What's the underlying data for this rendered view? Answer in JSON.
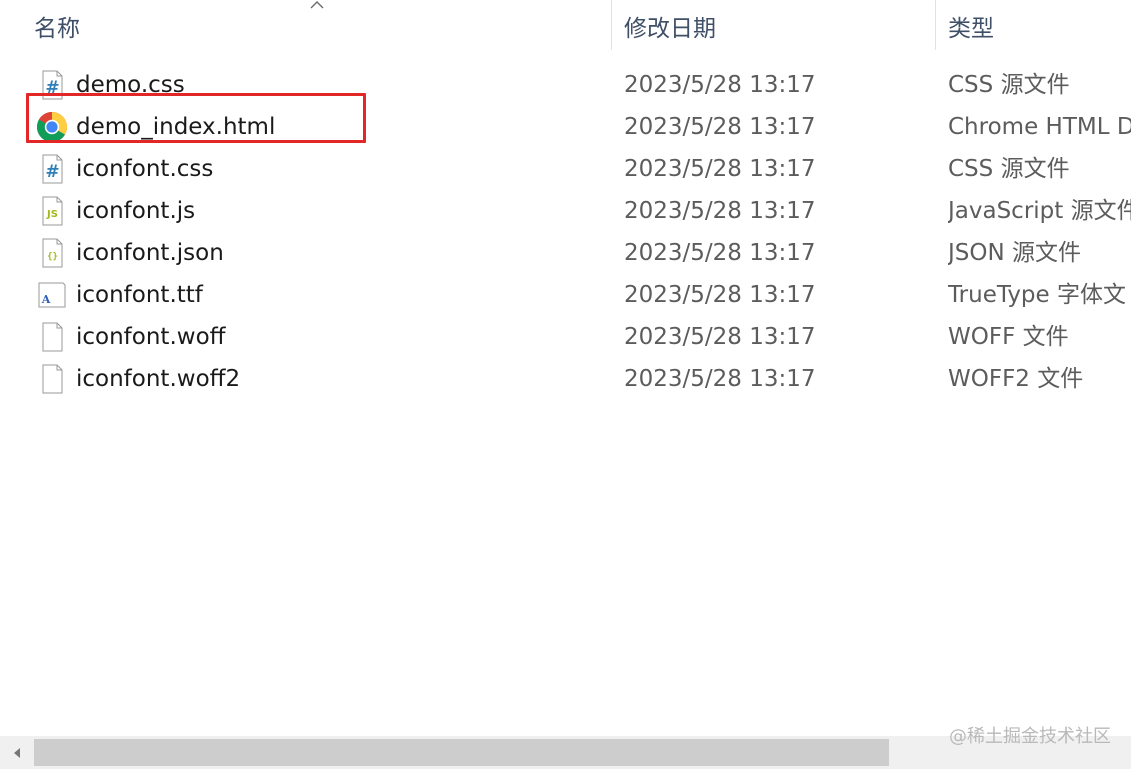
{
  "header": {
    "name": "名称",
    "date_modified": "修改日期",
    "type": "类型"
  },
  "files": [
    {
      "name": "demo.css",
      "date": "2023/5/28 13:17",
      "type": "CSS 源文件",
      "icon": "css-file-icon"
    },
    {
      "name": "demo_index.html",
      "date": "2023/5/28 13:17",
      "type": "Chrome HTML D",
      "icon": "chrome-icon"
    },
    {
      "name": "iconfont.css",
      "date": "2023/5/28 13:17",
      "type": "CSS 源文件",
      "icon": "css-file-icon"
    },
    {
      "name": "iconfont.js",
      "date": "2023/5/28 13:17",
      "type": "JavaScript 源文件",
      "icon": "js-file-icon"
    },
    {
      "name": "iconfont.json",
      "date": "2023/5/28 13:17",
      "type": "JSON 源文件",
      "icon": "json-file-icon"
    },
    {
      "name": "iconfont.ttf",
      "date": "2023/5/28 13:17",
      "type": "TrueType 字体文",
      "icon": "font-file-icon"
    },
    {
      "name": "iconfont.woff",
      "date": "2023/5/28 13:17",
      "type": "WOFF 文件",
      "icon": "blank-file-icon"
    },
    {
      "name": "iconfont.woff2",
      "date": "2023/5/28 13:17",
      "type": "WOFF2 文件",
      "icon": "blank-file-icon"
    }
  ],
  "watermark": "@稀土掘金技术社区",
  "colors": {
    "annotation": "#e32626",
    "header_text": "#3f4f68",
    "secondary_text": "#5c5c5c",
    "scrollbar_thumb": "#cdcdcd"
  }
}
